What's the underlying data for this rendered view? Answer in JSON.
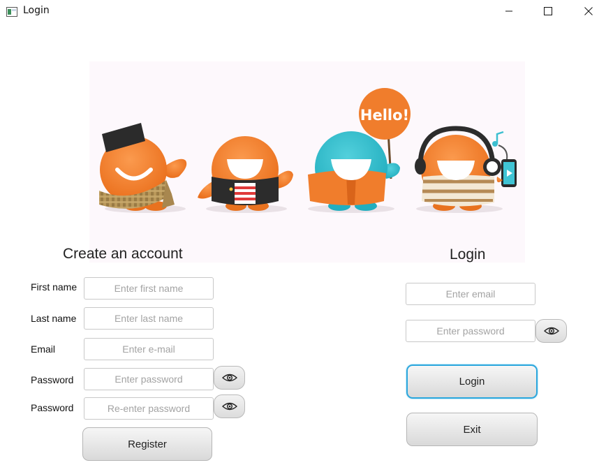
{
  "window": {
    "title": "Login",
    "controls": [
      "minimize",
      "maximize",
      "close"
    ]
  },
  "banner": {
    "sign_text": "Hello!"
  },
  "create_account": {
    "heading": "Create an account",
    "first_name": {
      "label": "First name",
      "value": "",
      "placeholder": "Enter first name"
    },
    "last_name": {
      "label": "Last name",
      "value": "",
      "placeholder": "Enter last name"
    },
    "email": {
      "label": "Email",
      "value": "",
      "placeholder": "Enter e-mail"
    },
    "password": {
      "label": "Password",
      "value": "",
      "placeholder": "Enter password"
    },
    "password_confirm": {
      "label": "Password",
      "value": "",
      "placeholder": "Re-enter password"
    },
    "register_label": "Register"
  },
  "login": {
    "heading": "Login",
    "email": {
      "value": "",
      "placeholder": "Enter email"
    },
    "password": {
      "value": "",
      "placeholder": "Enter password"
    },
    "login_label": "Login",
    "exit_label": "Exit"
  },
  "colors": {
    "orange": "#f07d2c",
    "teal": "#2fbccd",
    "banner_bg": "#fdf8fc",
    "focus_border": "#2aa6dd"
  },
  "icons": [
    "app-window-icon",
    "minimize-icon",
    "maximize-icon",
    "close-icon",
    "eye-icon"
  ]
}
